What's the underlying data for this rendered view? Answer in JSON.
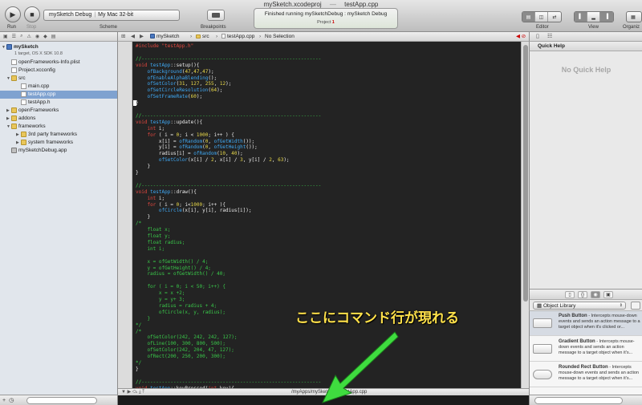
{
  "window": {
    "title_project": "mySketch.xcodeproj",
    "title_file": "testApp.cpp"
  },
  "toolbar": {
    "run_label": "Run",
    "stop_label": "Stop",
    "scheme_label": "Scheme",
    "breakpoints_label": "Breakpoints",
    "scheme_target": "mySketch Debug",
    "scheme_destination": "My Mac 32-bit",
    "activity_message": "Finished running mySketchDebug : mySketch Debug",
    "activity_project": "Project",
    "activity_issue_count": "1",
    "editor_label": "Editor",
    "view_label": "View",
    "organizer_label": "Organiz"
  },
  "navigator": {
    "project_name": "mySketch",
    "project_subtitle": "1 target, OS X SDK 10.8",
    "items": [
      {
        "label": "openFrameworks-Info.plist",
        "type": "file"
      },
      {
        "label": "Project.xcconfig",
        "type": "file"
      },
      {
        "label": "src",
        "type": "folder"
      },
      {
        "label": "main.cpp",
        "type": "file"
      },
      {
        "label": "testApp.cpp",
        "type": "file"
      },
      {
        "label": "testApp.h",
        "type": "file"
      },
      {
        "label": "openFrameworks",
        "type": "folder"
      },
      {
        "label": "addons",
        "type": "folder"
      },
      {
        "label": "frameworks",
        "type": "folder"
      },
      {
        "label": "3rd party frameworks",
        "type": "folder"
      },
      {
        "label": "system frameworks",
        "type": "folder"
      },
      {
        "label": "mySketchDebug.app",
        "type": "app"
      }
    ]
  },
  "jumpbar": {
    "crumbs": [
      "mySketch",
      "src",
      "testApp.cpp",
      "No Selection"
    ]
  },
  "code": [
    "#include \"testApp.h\"",
    "",
    "//--------------------------------------------------------------",
    "void testApp::setup(){",
    "    ofBackground(47,47,47);",
    "    ofEnableAlphaBlending();",
    "    ofSetColor(31, 127, 255, 12);",
    "    ofSetCircleResolution(64);",
    "    ofSetFrameRate(60);",
    "}",
    "",
    "//--------------------------------------------------------------",
    "void testApp::update(){",
    "    int i;",
    "    for ( i = 0; i < 1000; i++ ) {",
    "        x[i] = ofRandom(0, ofGetWidth());",
    "        y[i] = ofRandom(0, ofGetHeight());",
    "        radius[i] = ofRandom(10, 40);",
    "        ofSetColor(x[i] / 2, x[i] / 3, y[i] / 2, 63);",
    "    }",
    "}",
    "",
    "//--------------------------------------------------------------",
    "void testApp::draw(){",
    "    int i;",
    "    for ( i = 0; i<1000; i++ ){",
    "        ofCircle(x[i], y[i], radius[i]);",
    "    }",
    "/*",
    "    float x;",
    "    float y;",
    "    float radius;",
    "    int i;",
    "",
    "    x = ofGetWidth() / 4;",
    "    y = ofGetHeight() / 4;",
    "    radius = ofGetWidth() / 40;",
    "",
    "    for ( i = 0; i < 50; i++) {",
    "        x = x +2;",
    "        y = y+ 3;",
    "        radius = radius + 4;",
    "        ofCircle(x, y, radius);",
    "    }",
    "*/",
    "/*",
    "    ofSetColor(242, 242, 242, 127);",
    "    ofLine(100, 300, 800, 500);",
    "    ofSetColor(242, 204, 47, 127);",
    "    ofRect(200, 250, 200, 300);",
    "*/",
    "}",
    "",
    "//--------------------------------------------------------------",
    "void testApp::keyPressed(int key){",
    "",
    "}"
  ],
  "editor_footer": "/myApps/mySketch/src/testApp.cpp",
  "utilities": {
    "quick_help_title": "Quick Help",
    "no_quick_help": "No Quick Help",
    "library_selected": "Object Library",
    "library_items": [
      {
        "name": "Push Button",
        "desc": " - Intercepts mouse-down events and sends an action message to a target object when it's clicked or..."
      },
      {
        "name": "Gradient Button",
        "desc": " - Intercepts mouse-down events and sends an action message to a target object when it's..."
      },
      {
        "name": "Rounded Rect Button",
        "desc": " - Intercepts mouse-down events and sends an action message to a target object when it's..."
      }
    ]
  },
  "annotation": {
    "text": "ここにコマンド行が現れる",
    "color": "#ffe14a",
    "arrow_color": "#3fdc3f"
  }
}
